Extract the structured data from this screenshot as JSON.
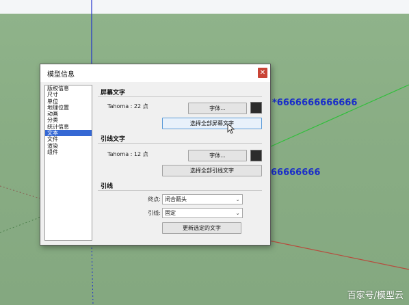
{
  "scene": {
    "text_right_1": "*6666666666666",
    "text_right_2": "66666666",
    "watermark": "百家号/模型云",
    "colors": {
      "ground": "#8aad84",
      "sky": "#f4f6f8",
      "blue_axis": "#2233cc",
      "green_axis": "#2fbf3a",
      "red_axis": "#b84a3c"
    }
  },
  "dialog": {
    "title": "模型信息",
    "close_icon": "close-x-icon",
    "sidebar": {
      "items": [
        {
          "label": "版权信息",
          "selected": false
        },
        {
          "label": "尺寸",
          "selected": false
        },
        {
          "label": "单位",
          "selected": false
        },
        {
          "label": "地理位置",
          "selected": false
        },
        {
          "label": "动画",
          "selected": false
        },
        {
          "label": "分类",
          "selected": false
        },
        {
          "label": "统计信息",
          "selected": false
        },
        {
          "label": "文本",
          "selected": true
        },
        {
          "label": "文件",
          "selected": false
        },
        {
          "label": "渲染",
          "selected": false
        },
        {
          "label": "组件",
          "selected": false
        }
      ]
    },
    "screen_text": {
      "heading": "屏幕文字",
      "font_label": "Tahoma : 22 点",
      "font_button": "字体...",
      "select_all_button": "选择全部屏幕文字",
      "swatch_color": "#2c2c2c"
    },
    "leader_text": {
      "heading": "引线文字",
      "font_label": "Tahoma : 12 点",
      "font_button": "字体...",
      "select_all_button": "选择全部引线文字",
      "swatch_color": "#2c2c2c"
    },
    "leader_lines": {
      "heading": "引线",
      "endpoint_label": "终点:",
      "endpoint_value": "闭合箭头",
      "leader_label": "引线:",
      "leader_value": "固定",
      "update_button": "更新选定的文字"
    }
  }
}
